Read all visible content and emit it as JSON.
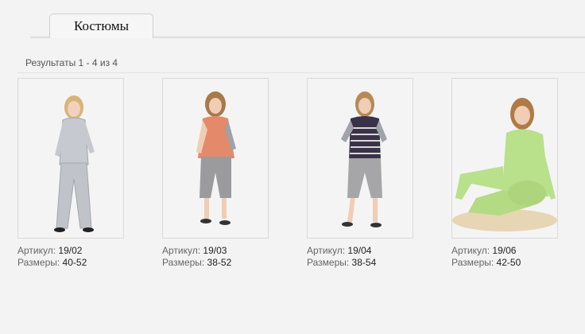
{
  "tab": {
    "label": "Костюмы"
  },
  "results": {
    "text": "Результаты 1 - 4 из 4"
  },
  "products": [
    {
      "article_label": "Артикул:",
      "article": "19/02",
      "sizes_label": "Размеры:",
      "sizes": "40-52",
      "top_color": "#c8ccd2",
      "bottom_color": "#bfc3c9"
    },
    {
      "article_label": "Артикул:",
      "article": "19/03",
      "sizes_label": "Размеры:",
      "sizes": "38-52",
      "top_color": "#e58a6a",
      "bottom_color": "#9a9a9c"
    },
    {
      "article_label": "Артикул:",
      "article": "19/04",
      "sizes_label": "Размеры:",
      "sizes": "38-54",
      "top_color": "#3a3248",
      "bottom_color": "#a6a6a8"
    },
    {
      "article_label": "Артикул:",
      "article": "19/06",
      "sizes_label": "Размеры:",
      "sizes": "42-50",
      "top_color": "#b9e08a",
      "bottom_color": "#b9e08a"
    }
  ]
}
